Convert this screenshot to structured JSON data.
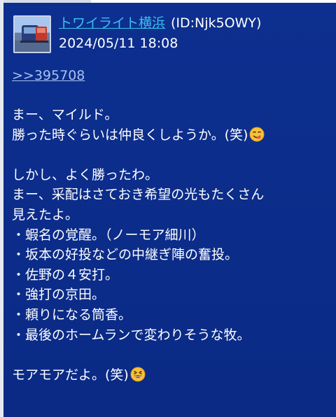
{
  "post": {
    "author_name": "トワイライト横浜",
    "author_id": "(ID:Njk5OWY)",
    "timestamp": "2024/05/11 18:08",
    "reply_link": ">>395708",
    "paragraphs": [
      [
        "まー、マイルド。",
        "勝った時ぐらいは仲良くしようか。(笑)"
      ],
      [
        "しかし、よく勝ったわ。",
        "まー、采配はさておき希望の光もたくさん",
        "見えたよ。",
        "・蝦名の覚醒。（ノーモア細川）",
        "・坂本の好投などの中継ぎ陣の奮投。",
        "・佐野の４安打。",
        "・強打の京田。",
        "・頼りになる筒香。",
        "・最後のホームランで変わりそうな牧。"
      ],
      [
        "モアモアだよ。(笑)"
      ]
    ],
    "emojis": {
      "first": "yum-face-emoji",
      "last": "grinning-squint-face-emoji"
    }
  },
  "colors": {
    "background": "#0b2b86",
    "author_link": "#3bc0f0",
    "reply_link": "#a8c0f0",
    "text": "#ffffff"
  }
}
